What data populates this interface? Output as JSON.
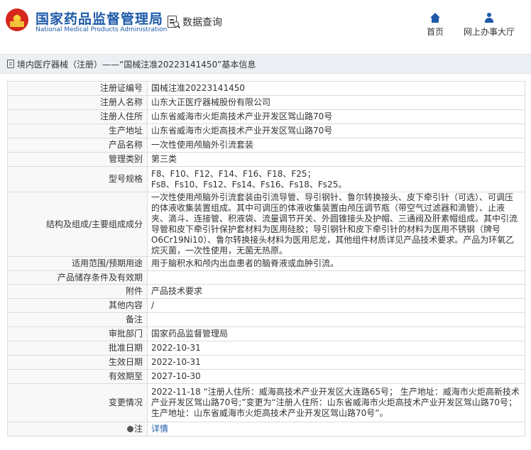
{
  "header": {
    "brand_cn": "国家药品监督管理局",
    "brand_en": "National Medical Products Administration",
    "query_label": "数据查询",
    "nav": [
      {
        "label": "首页",
        "icon": "home-icon"
      },
      {
        "label": "网上办事大厅",
        "icon": "user-icon"
      }
    ],
    "colors": {
      "brand": "#1e5aa8",
      "logo_red": "#d6261e",
      "logo_gold": "#f7c531"
    }
  },
  "breadcrumb": {
    "text": "境内医疗器械（注册）——“国械注准20223141450”基本信息"
  },
  "details": {
    "rows": [
      {
        "label": "注册证编号",
        "value": "国械注准20223141450"
      },
      {
        "label": "注册人名称",
        "value": "山东大正医疗器械股份有限公司"
      },
      {
        "label": "注册人住所",
        "value": "山东省威海市火炬高技术产业开发区驾山路70号"
      },
      {
        "label": "生产地址",
        "value": "山东省威海市火炬高技术产业开发区驾山路70号"
      },
      {
        "label": "产品名称",
        "value": "一次性使用颅脑外引流套装"
      },
      {
        "label": "管理类别",
        "value": "第三类"
      },
      {
        "label": "型号规格",
        "value_line1": "F8、F10、F12、F14、F16、F18、F25；",
        "value_line2": "Fs8、Fs10、Fs12、Fs14、Fs16、Fs18、Fs25。"
      },
      {
        "label": "结构及组成/主要组成成分",
        "value": "一次性使用颅脑外引流套装由引流导管、导引钢针、鲁尔转换接头、皮下牵引针（可选）、可调压的体液收集装置组成。其中可调压的体液收集装置由颅压调节瓶（带空气过滤器和滴管）、止液夹、滴斗、连接管、积液袋、流量调节开关、外圆锥接头及护帽、三通阀及肝素帽组成。其中引流导管和皮下牵引针保护套材料为医用硅胶；导引钢针和皮下牵引针的材料为医用不锈钢（牌号O6Cr19Ni10）、鲁尔转换接头材料为医用尼龙，其他组件材质详见产品技术要求。产品为环氧乙烷灭菌，一次性使用，无菌无热原。"
      },
      {
        "label": "适用范围/预期用途",
        "value": "用于脑积水和颅内出血患者的脑脊液或血肿引流。"
      },
      {
        "label": "产品储存条件及有效期",
        "value": ""
      },
      {
        "label": "附件",
        "value": "产品技术要求"
      },
      {
        "label": "其他内容",
        "value": "/"
      },
      {
        "label": "备注",
        "value": ""
      },
      {
        "label": "审批部门",
        "value": "国家药品监督管理局"
      },
      {
        "label": "批准日期",
        "value": "2022-10-31"
      },
      {
        "label": "生效日期",
        "value": "2022-10-31"
      },
      {
        "label": "有效期至",
        "value": "2027-10-30"
      },
      {
        "label": "变更情况",
        "value": "2022-11-18 “注册人住所：威海高技术产业开发区大连路65号； 生产地址：威海市火炬高新技术产业开发区驾山路70号;”变更为“注册人住所：山东省威海市火炬高技术产业开发区驾山路70号；生产地址：山东省威海市火炬高技术产业开发区驾山路70号”。"
      },
      {
        "label": "注",
        "value": "详情",
        "icon": "circle-dot-icon"
      }
    ]
  }
}
